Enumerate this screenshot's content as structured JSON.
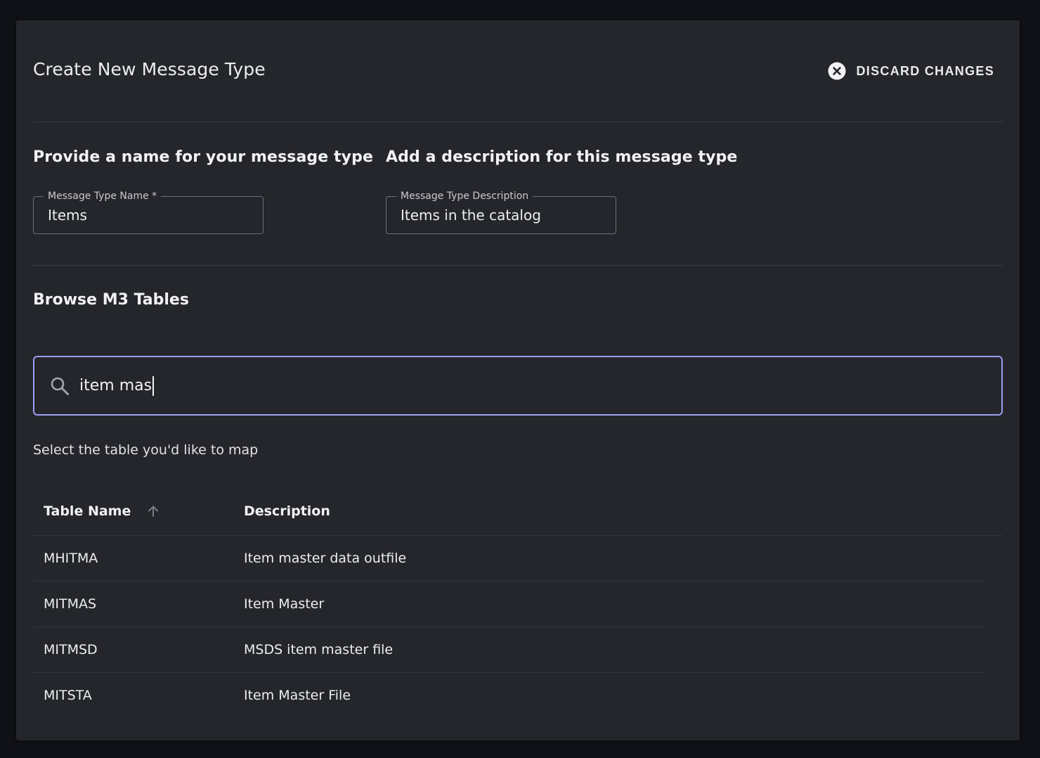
{
  "header": {
    "title": "Create New Message Type",
    "discard_label": "DISCARD CHANGES"
  },
  "name_section": {
    "heading": "Provide a name for your message type",
    "field_label": "Message Type Name *",
    "field_value": "Items"
  },
  "description_section": {
    "heading": "Add a description for this message type",
    "field_label": "Message Type Description",
    "field_value": "Items in the catalog"
  },
  "browse": {
    "heading": "Browse M3 Tables",
    "search_value": "item mas",
    "hint": "Select the table you'd like to map"
  },
  "table": {
    "columns": {
      "name": "Table Name",
      "description": "Description"
    },
    "sort": "ascending",
    "rows": [
      {
        "name": "MHITMA",
        "description": "Item master data outfile"
      },
      {
        "name": "MITMAS",
        "description": "Item Master"
      },
      {
        "name": "MITMSD",
        "description": "MSDS item master file"
      },
      {
        "name": "MITSTA",
        "description": "Item Master File"
      }
    ]
  },
  "colors": {
    "background": "#101116",
    "panel": "#25262b",
    "focus_border": "#9b9ef2"
  },
  "icons": {
    "discard": "close-circle-icon",
    "search": "search-icon",
    "sort": "arrow-up-icon"
  }
}
